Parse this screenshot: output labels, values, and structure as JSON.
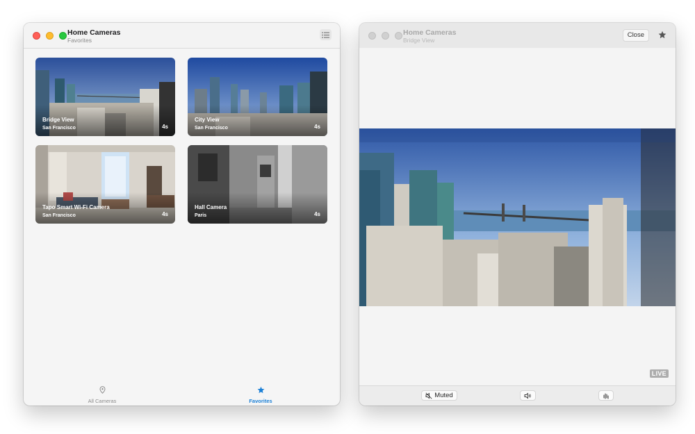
{
  "left_window": {
    "title": "Home Cameras",
    "subtitle": "Favorites",
    "toolbar": {
      "list_icon": "list-icon"
    },
    "cameras": [
      {
        "name": "Bridge View",
        "location": "San Francisco",
        "age": "4s"
      },
      {
        "name": "City View",
        "location": "San Francisco",
        "age": "4s"
      },
      {
        "name": "Tapo Smart Wi-Fi Camera",
        "location": "San Francisco",
        "age": "4s"
      },
      {
        "name": "Hall Camera",
        "location": "Paris",
        "age": "4s"
      }
    ],
    "tabs": [
      {
        "label": "All Cameras",
        "icon": "location-pin-icon",
        "active": false
      },
      {
        "label": "Favorites",
        "icon": "star-icon",
        "active": true
      }
    ]
  },
  "right_window": {
    "title": "Home Cameras",
    "subtitle": "Bridge View",
    "close_label": "Close",
    "favorite_icon": "star-icon",
    "live_label": "LIVE",
    "controls": {
      "muted_label": "Muted",
      "muted_icon": "speaker-slash-icon",
      "volume_icon": "speaker-icon",
      "talk_icon": "waveform-icon"
    }
  },
  "colors": {
    "accent": "#1a7fd6",
    "red": "#ff5f57",
    "yellow": "#febc2e",
    "green": "#28c840"
  }
}
